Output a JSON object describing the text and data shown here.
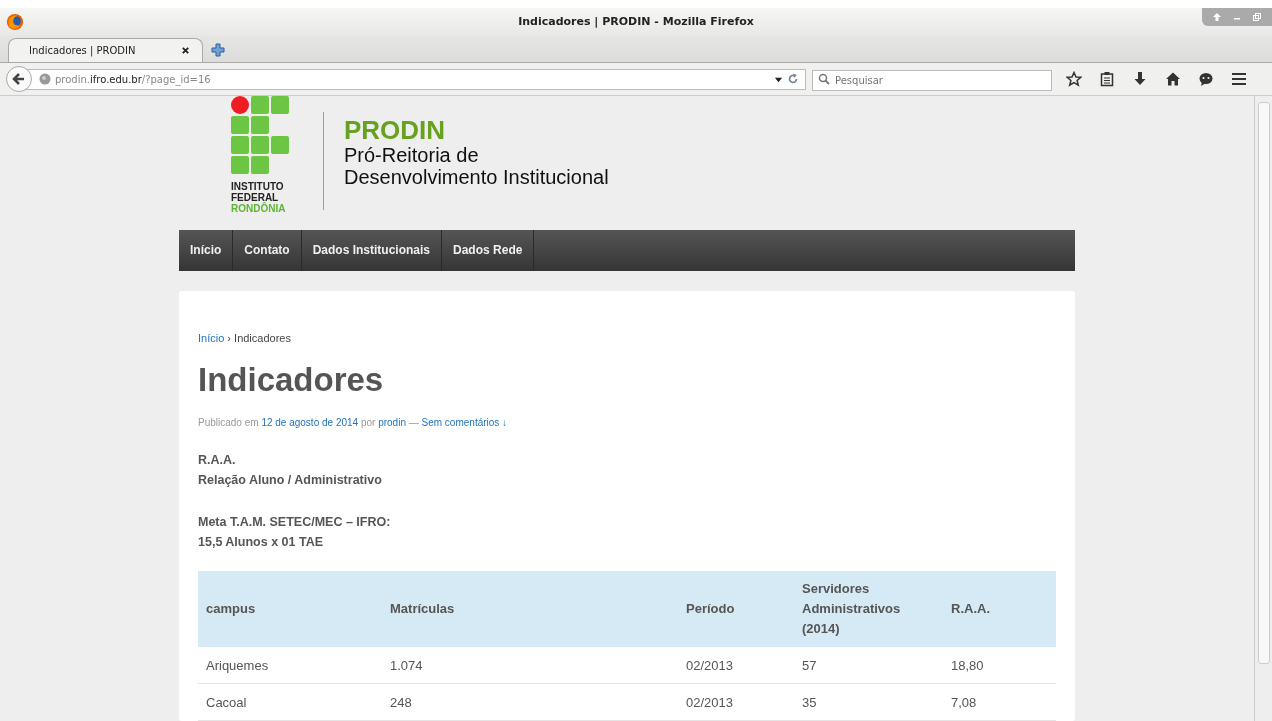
{
  "window": {
    "title": "Indicadores | PRODIN - Mozilla Firefox"
  },
  "tabs": [
    {
      "label": "Indicadores | PRODIN",
      "selected": true
    }
  ],
  "address_bar": {
    "prefix": "prodin.",
    "domain": "ifro.edu.br",
    "path": "/?page_id=16"
  },
  "search": {
    "placeholder": "Pesquisar"
  },
  "site": {
    "logo_lines": [
      "INSTITUTO",
      "FEDERAL"
    ],
    "logo_region": "RONDÔNIA",
    "name": "PRODIN",
    "subtitle": [
      "Pró-Reitoria de",
      "Desenvolvimento Institucional"
    ]
  },
  "menu": [
    {
      "label": "Início"
    },
    {
      "label": "Contato"
    },
    {
      "label": "Dados Institucionais"
    },
    {
      "label": "Dados Rede"
    }
  ],
  "breadcrumb": {
    "link": "Início",
    "separator": "›",
    "current": "Indicadores"
  },
  "post": {
    "title": "Indicadores",
    "meta_prefix": "Publicado em",
    "date": "12 de agosto de 2014",
    "meta_by": "por",
    "author": "prodin",
    "meta_dash": "—",
    "comments": "Sem comentários ↓",
    "paragraphs": [
      [
        "R.A.A.",
        "Relação Aluno / Administrativo"
      ],
      [
        "Meta T.A.M. SETEC/MEC – IFRO:",
        "15,5 Alunos x 01 TAE"
      ]
    ]
  },
  "table": {
    "columns": [
      "campus",
      "Matrículas",
      "Período",
      "Servidores Administrativos (2014)",
      "R.A.A."
    ],
    "rows": [
      [
        "Ariquemes",
        "1.074",
        "02/2013",
        "57",
        "18,80"
      ],
      [
        "Cacoal",
        "248",
        "02/2013",
        "35",
        "7,08"
      ]
    ]
  }
}
